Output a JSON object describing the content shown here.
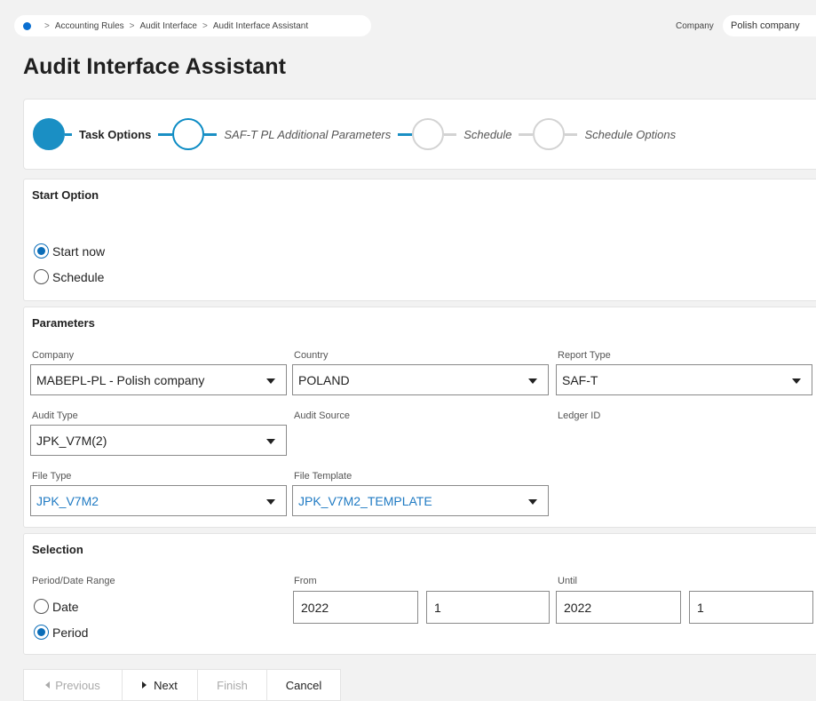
{
  "breadcrumb": {
    "items": [
      "Accounting Rules",
      "Audit Interface",
      "Audit Interface Assistant"
    ]
  },
  "context": {
    "company_label": "Company",
    "company_value": "Polish company"
  },
  "page_title": "Audit Interface Assistant",
  "stepper": {
    "steps": [
      {
        "label": "Task Options",
        "state": "completed"
      },
      {
        "label": "SAF-T PL Additional Parameters",
        "state": "current"
      },
      {
        "label": "Schedule",
        "state": "pending"
      },
      {
        "label": "Schedule Options",
        "state": "pending"
      }
    ]
  },
  "start_option": {
    "title": "Start Option",
    "options": [
      {
        "label": "Start now",
        "selected": true
      },
      {
        "label": "Schedule",
        "selected": false
      }
    ]
  },
  "parameters": {
    "title": "Parameters",
    "company": {
      "label": "Company",
      "value": "MABEPL-PL - Polish company"
    },
    "country": {
      "label": "Country",
      "value": "POLAND"
    },
    "report_type": {
      "label": "Report Type",
      "value": "SAF-T"
    },
    "audit_type": {
      "label": "Audit Type",
      "value": "JPK_V7M(2)"
    },
    "audit_source": {
      "label": "Audit Source"
    },
    "ledger_id": {
      "label": "Ledger ID"
    },
    "file_type": {
      "label": "File Type",
      "value": "JPK_V7M2"
    },
    "file_template": {
      "label": "File Template",
      "value": "JPK_V7M2_TEMPLATE"
    }
  },
  "selection": {
    "title": "Selection",
    "range_label": "Period/Date Range",
    "options": [
      {
        "label": "Date",
        "selected": false
      },
      {
        "label": "Period",
        "selected": true
      }
    ],
    "from": {
      "label": "From",
      "year": "2022",
      "period": "1"
    },
    "until": {
      "label": "Until",
      "year": "2022",
      "period": "1"
    }
  },
  "footer": {
    "previous": "Previous",
    "next": "Next",
    "finish": "Finish",
    "cancel": "Cancel"
  },
  "colors": {
    "accent": "#1a8fc4",
    "link": "#1f7ac3",
    "radio_selected": "#0b6db8"
  }
}
